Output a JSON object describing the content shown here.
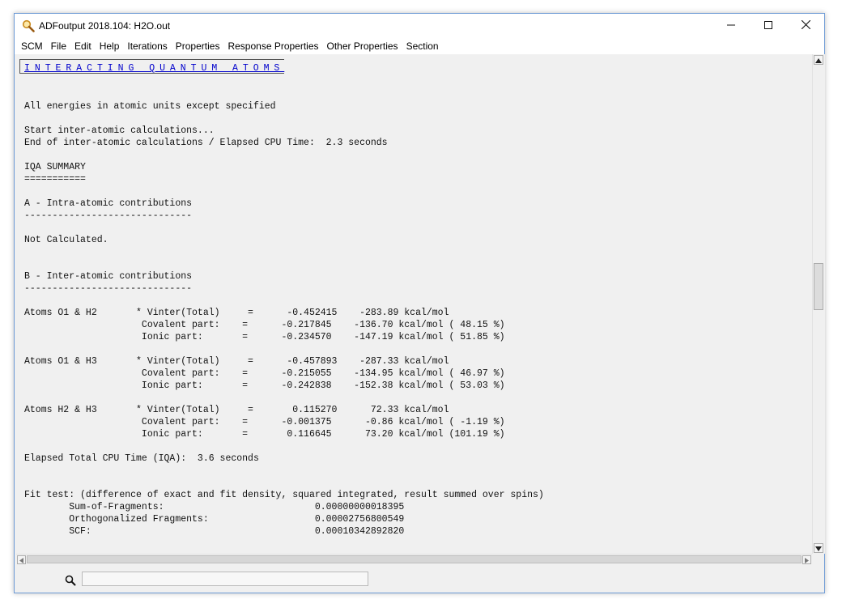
{
  "window": {
    "title": "ADFoutput 2018.104: H2O.out",
    "icon": "magnifier-app-icon",
    "controls": {
      "minimize": "minimize-icon",
      "maximize": "maximize-icon",
      "close": "close-icon"
    }
  },
  "menubar": {
    "items": [
      {
        "label": "SCM"
      },
      {
        "label": "File"
      },
      {
        "label": "Edit"
      },
      {
        "label": "Help"
      },
      {
        "label": "Iterations"
      },
      {
        "label": "Properties"
      },
      {
        "label": "Response Properties"
      },
      {
        "label": "Other Properties"
      },
      {
        "label": "Section"
      }
    ]
  },
  "output": {
    "heading": "INTERACTING QUANTUM ATOMS",
    "lines": [
      "All energies in atomic units except specified",
      "Start inter-atomic calculations...",
      "End of inter-atomic calculations / Elapsed CPU Time:  2.3 seconds",
      "IQA SUMMARY",
      "===========",
      "A - Intra-atomic contributions",
      "------------------------------",
      "Not Calculated.",
      "B - Inter-atomic contributions",
      "------------------------------",
      "Atoms O1 & H2       * Vinter(Total)     =      -0.452415    -283.89 kcal/mol",
      "                     Covalent part:    =      -0.217845    -136.70 kcal/mol ( 48.15 %)",
      "                     Ionic part:       =      -0.234570    -147.19 kcal/mol ( 51.85 %)",
      "Atoms O1 & H3       * Vinter(Total)     =      -0.457893    -287.33 kcal/mol",
      "                     Covalent part:    =      -0.215055    -134.95 kcal/mol ( 46.97 %)",
      "                     Ionic part:       =      -0.242838    -152.38 kcal/mol ( 53.03 %)",
      "Atoms H2 & H3       * Vinter(Total)     =       0.115270      72.33 kcal/mol",
      "                     Covalent part:    =      -0.001375      -0.86 kcal/mol ( -1.19 %)",
      "                     Ionic part:       =       0.116645      73.20 kcal/mol (101.19 %)",
      "Elapsed Total CPU Time (IQA):  3.6 seconds",
      "Fit test: (difference of exact and fit density, squared integrated, result summed over spins)",
      "        Sum-of-Fragments:                           0.00000000018395",
      "        Orthogonalized Fragments:                   0.00002756800549",
      "        SCF:                                        0.00010342892820"
    ]
  },
  "scrollbars": {
    "up": "scroll-up-arrow-icon",
    "down": "scroll-down-arrow-icon",
    "left": "scroll-left-arrow-icon",
    "right": "scroll-right-arrow-icon"
  },
  "statusbar": {
    "search_icon": "search-icon",
    "search_value": ""
  }
}
